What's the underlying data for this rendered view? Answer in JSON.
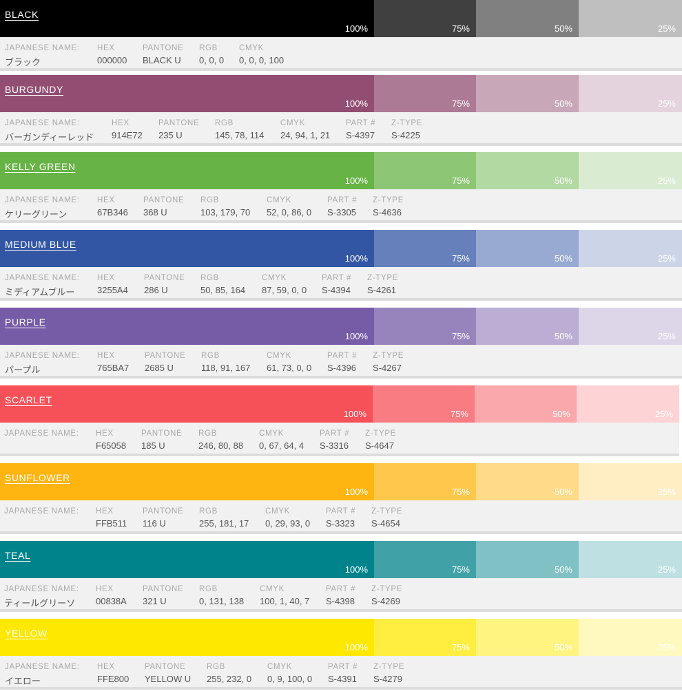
{
  "labels": {
    "japanese": "JAPANESE NAME:",
    "hex": "HEX",
    "pantone": "PANTONE",
    "rgb": "RGB",
    "cmyk": "CMYK",
    "part": "PART #",
    "ztype": "Z-TYPE"
  },
  "percent_labels": [
    "100%",
    "75%",
    "50%",
    "25%"
  ],
  "tint_levels": [
    1.0,
    0.75,
    0.5,
    0.25
  ],
  "colors": [
    {
      "name": "BLACK",
      "color": "#000000",
      "japanese": "ブラック",
      "hex": "000000",
      "pantone": "BLACK U",
      "rgb": "0, 0, 0",
      "cmyk": "0, 0, 0, 100",
      "part": "",
      "ztype": ""
    },
    {
      "name": "BURGUNDY",
      "color": "#914E72",
      "japanese": "バーガンディーレッド",
      "hex": "914E72",
      "pantone": "235 U",
      "rgb": "145, 78, 114",
      "cmyk": "24, 94, 1, 21",
      "part": "S-4397",
      "ztype": "S-4225"
    },
    {
      "name": "KELLY GREEN",
      "color": "#67B346",
      "japanese": "ケリーグリーン",
      "hex": "67B346",
      "pantone": "368 U",
      "rgb": "103, 179, 70",
      "cmyk": "52, 0, 86, 0",
      "part": "S-3305",
      "ztype": "S-4636"
    },
    {
      "name": "MEDIUM BLUE",
      "color": "#3255A4",
      "japanese": "ミディアムブルー",
      "hex": "3255A4",
      "pantone": "286 U",
      "rgb": "50, 85, 164",
      "cmyk": "87, 59, 0, 0",
      "part": "S-4394",
      "ztype": "S-4261"
    },
    {
      "name": "PURPLE",
      "color": "#765BA7",
      "japanese": "パープル",
      "hex": "765BA7",
      "pantone": "2685 U",
      "rgb": "118, 91, 167",
      "cmyk": "61, 73, 0, 0",
      "part": "S-4396",
      "ztype": "S-4267"
    },
    {
      "name": "SCARLET",
      "color": "#F65058",
      "japanese": "",
      "hex": "F65058",
      "pantone": "185 U",
      "rgb": "246, 80, 88",
      "cmyk": "0, 67, 64, 4",
      "part": "S-3316",
      "ztype": "S-4647"
    },
    {
      "name": "SUNFLOWER",
      "color": "#FFB511",
      "japanese": "",
      "hex": "FFB511",
      "pantone": "116 U",
      "rgb": "255, 181, 17",
      "cmyk": "0, 29, 93, 0",
      "part": "S-3323",
      "ztype": "S-4654"
    },
    {
      "name": "TEAL",
      "color": "#00838A",
      "japanese": "ティールグリーソ",
      "hex": "00838A",
      "pantone": "321 U",
      "rgb": "0, 131, 138",
      "cmyk": "100, 1, 40, 7",
      "part": "S-4398",
      "ztype": "S-4269"
    },
    {
      "name": "YELLOW",
      "color": "#FFE800",
      "japanese": "イエロー",
      "hex": "FFE800",
      "pantone": "YELLOW U",
      "rgb": "255, 232, 0",
      "cmyk": "0, 9, 100, 0",
      "part": "S-4391",
      "ztype": "S-4279"
    }
  ]
}
